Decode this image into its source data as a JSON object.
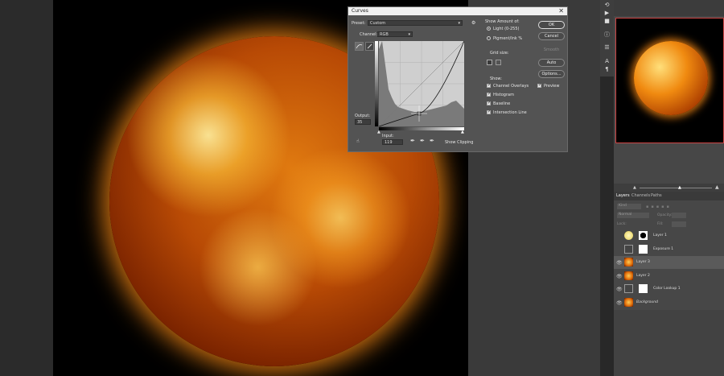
{
  "dialog": {
    "title": "Curves",
    "close_glyph": "✕",
    "preset_label": "Preset:",
    "preset_value": "Custom",
    "channel_label": "Channel:",
    "channel_value": "RGB",
    "output_label": "Output:",
    "output_value": "35",
    "input_label": "Input:",
    "input_value": "119",
    "show_clipping": "Show Clipping",
    "show_amount_label": "Show Amount of:",
    "light_option": "Light  (0-255)",
    "pigment_option": "Pigment/Ink %",
    "grid_size_label": "Grid size:",
    "show_label": "Show:",
    "channel_overlays": "Channel Overlays",
    "histogram": "Histogram",
    "baseline": "Baseline",
    "intersection_line": "Intersection Line",
    "ok_label": "OK",
    "cancel_label": "Cancel",
    "smooth_label": "Smooth",
    "auto_label": "Auto",
    "options_label": "Options...",
    "preview_label": "Preview"
  },
  "panels": {
    "tabs": [
      "Layers",
      "Channels",
      "Paths"
    ],
    "search_placeholder": "Kind",
    "blend_mode": "Normal",
    "opacity_label": "Opacity:",
    "lock_label": "Lock:",
    "fill_label": "Fill:"
  },
  "layers": [
    {
      "name": "Layer 1",
      "visible": false,
      "selected": false
    },
    {
      "name": "Exposure 1",
      "visible": false,
      "selected": false
    },
    {
      "name": "Layer 3",
      "visible": true,
      "selected": true
    },
    {
      "name": "Layer 2",
      "visible": true,
      "selected": false
    },
    {
      "name": "Color Lookup 1",
      "visible": true,
      "selected": false
    },
    {
      "name": "Background",
      "visible": true,
      "selected": false
    }
  ],
  "colors": {
    "canvas_bg": "#000000",
    "dialog_bg": "#535353",
    "panel_bg": "#474747",
    "selected_layer": "#5a5a5a"
  }
}
